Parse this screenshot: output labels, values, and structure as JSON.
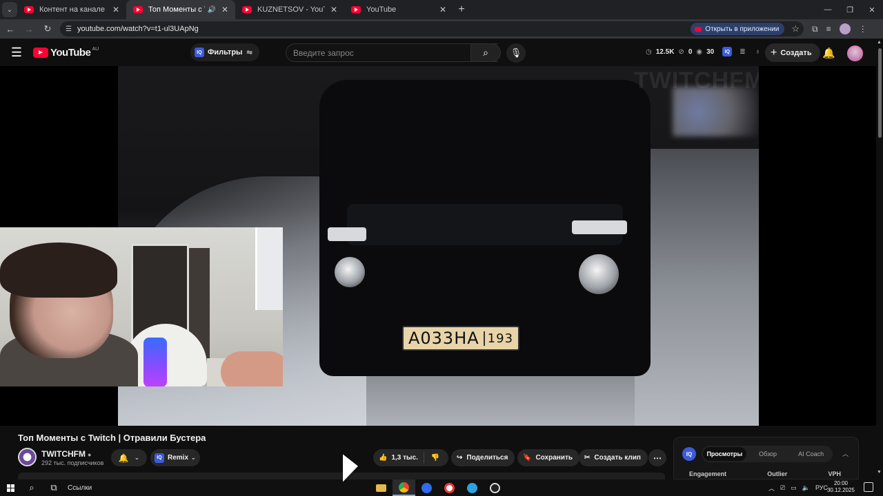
{
  "browser": {
    "tabs": [
      {
        "title": "Контент на канале - YouTube Studio",
        "active": false
      },
      {
        "title": "Топ Моменты с Twitch | Отравили Бустера",
        "active": true
      },
      {
        "title": "KUZNETSOV - YouTube",
        "active": false
      },
      {
        "title": "YouTube",
        "active": false
      }
    ],
    "url": "youtube.com/watch?v=t1-ul3UApNg",
    "open_in_app_label": "Открыть в приложении"
  },
  "youtube": {
    "logo_word": "YouTube",
    "country_code": "AU",
    "filters_label": "Фильтры",
    "search_placeholder": "Введите запрос",
    "stats": {
      "views": "12.5K",
      "a": "0",
      "b": "30"
    },
    "create_label": "Создать"
  },
  "video": {
    "plate_text": "A033HA",
    "plate_region": "193",
    "watermark": "TWITCHFM",
    "title": "Топ Моменты с Twitch | Отравили Бустера"
  },
  "channel": {
    "name": "TWITCHFM",
    "subscribers": "292 тыс. подписчиков",
    "remix_label": "Remix"
  },
  "actions": {
    "likes": "1,3 тыс.",
    "share_label": "Поделиться",
    "save_label": "Сохранить",
    "clip_label": "Создать клип"
  },
  "panel": {
    "tabs": [
      "Просмотры",
      "Обзор",
      "AI Coach"
    ],
    "columns": [
      "Engagement",
      "Outlier",
      "VPH"
    ]
  },
  "taskbar": {
    "links_label": "Ссылки",
    "lang": "РУС",
    "time": "20:00",
    "date": "30.12.2025"
  },
  "colors": {
    "youtube_red": "#ff0033",
    "accent_blue": "#3b5bd9",
    "background": "#0f0f0f"
  }
}
